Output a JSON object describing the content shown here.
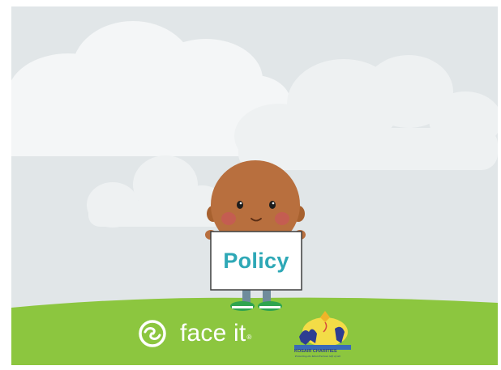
{
  "sign": {
    "label": "Policy"
  },
  "brand": {
    "name": "face it",
    "registered_mark": "®",
    "icon": "face-it-swirl-icon"
  },
  "partner": {
    "name": "KOSAIR CHARITIES",
    "tagline": "Protecting the Most Precious Gift of All"
  },
  "colors": {
    "sky": "#e1e6e8",
    "cloud": "#f4f6f7",
    "grass": "#8cc63f",
    "skin": "#b86f3e",
    "sign_text": "#2ea8b6",
    "shoes": "#2fa44f"
  }
}
